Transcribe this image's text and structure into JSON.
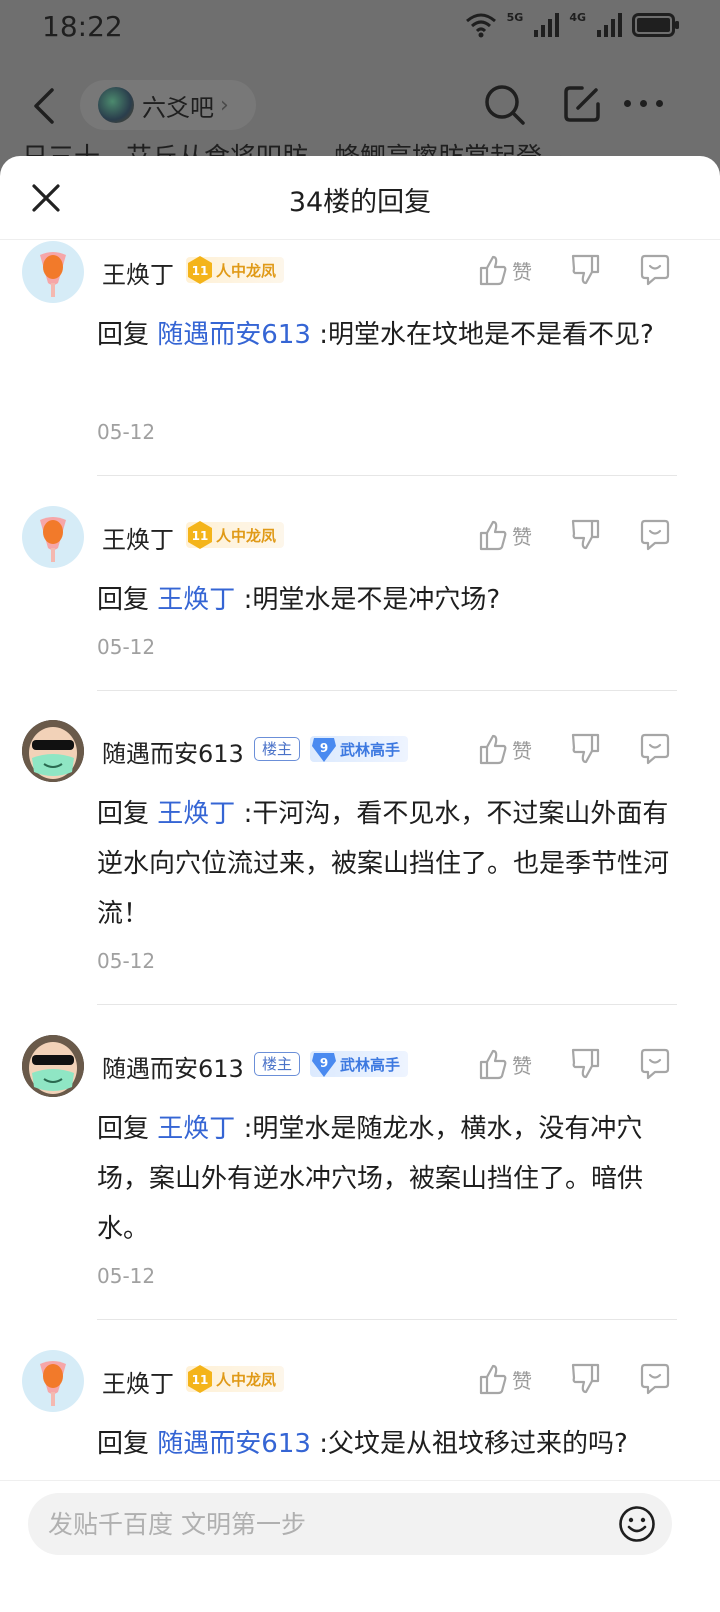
{
  "status_bar": {
    "time": "18:22",
    "net1": "5G",
    "net2": "4G"
  },
  "nav": {
    "forum_name": "六爻吧",
    "chevron": "›",
    "peek_text": "日三十，艾丘从食将叩肪，蜂鲫亭擦肪赏起登~"
  },
  "sheet": {
    "title": "34楼的回复",
    "like_label": "赞"
  },
  "replies": [
    {
      "user": "王焕丁",
      "level": "11",
      "level_title": "人中龙凤",
      "prefix": "回复",
      "mention": "随遇而安613",
      "text": ":明堂水在坟地是不是看不见?",
      "date": "05-12"
    },
    {
      "user": "王焕丁",
      "level": "11",
      "level_title": "人中龙凤",
      "prefix": "回复",
      "mention": "王焕丁",
      "text": ":明堂水是不是冲穴场?",
      "date": "05-12"
    },
    {
      "user": "随遇而安613",
      "owner_badge": "楼主",
      "level": "9",
      "level_title": "武林高手",
      "prefix": "回复",
      "mention": "王焕丁",
      "text": ":干河沟，看不见水，不过案山外面有逆水向穴位流过来，被案山挡住了。也是季节性河流！",
      "date": "05-12"
    },
    {
      "user": "随遇而安613",
      "owner_badge": "楼主",
      "level": "9",
      "level_title": "武林高手",
      "prefix": "回复",
      "mention": "王焕丁",
      "text": ":明堂水是随龙水，横水，没有冲穴场，案山外有逆水冲穴场，被案山挡住了。暗供水。",
      "date": "05-12"
    },
    {
      "user": "王焕丁",
      "level": "11",
      "level_title": "人中龙凤",
      "prefix": "回复",
      "mention": "随遇而安613",
      "text": ":父坟是从祖坟移过来的吗?",
      "date": ""
    }
  ],
  "compose": {
    "placeholder": "发贴千百度 文明第一步"
  },
  "icons": {
    "back": "chevron-left-icon",
    "search": "search-icon",
    "edit": "edit-icon",
    "more": "more-icon",
    "close": "close-icon",
    "like": "thumb-up-icon",
    "dislike": "thumb-down-icon",
    "reply": "comment-icon",
    "emoji": "emoji-icon"
  },
  "colors": {
    "mention": "#3565d4",
    "gold_badge": "#e09a18",
    "blue_badge": "#3c78e0"
  }
}
